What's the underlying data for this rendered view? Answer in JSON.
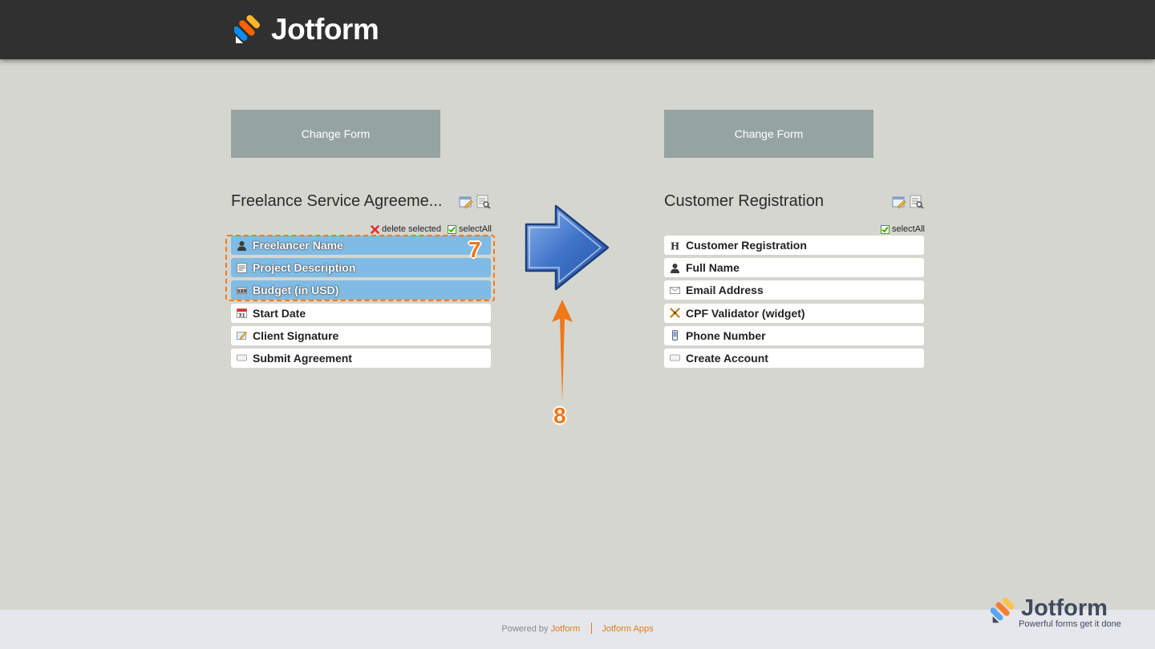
{
  "app": {
    "name": "Jotform"
  },
  "left": {
    "change_button": "Change Form",
    "title": "Freelance Service Agreeme...",
    "delete_selected": "delete selected",
    "select_all": "selectAll",
    "fields": [
      {
        "label": "Freelancer Name",
        "icon": "person-icon",
        "selected": true
      },
      {
        "label": "Project Description",
        "icon": "textarea-icon",
        "selected": true
      },
      {
        "label": "Budget (in USD)",
        "icon": "number-icon",
        "selected": true
      },
      {
        "label": "Start Date",
        "icon": "calendar-icon",
        "selected": false
      },
      {
        "label": "Client Signature",
        "icon": "signature-icon",
        "selected": false
      },
      {
        "label": "Submit Agreement",
        "icon": "button-icon",
        "selected": false
      }
    ]
  },
  "right": {
    "change_button": "Change Form",
    "title": "Customer Registration",
    "select_all": "selectAll",
    "fields": [
      {
        "label": "Customer Registration",
        "icon": "heading-icon"
      },
      {
        "label": "Full Name",
        "icon": "person-icon"
      },
      {
        "label": "Email Address",
        "icon": "email-icon"
      },
      {
        "label": "CPF Validator (widget)",
        "icon": "widget-icon"
      },
      {
        "label": "Phone Number",
        "icon": "phone-icon"
      },
      {
        "label": "Create Account",
        "icon": "button-icon"
      }
    ]
  },
  "annotations": {
    "step7": "7",
    "step8": "8"
  },
  "footer": {
    "powered_by": "Powered by",
    "jotform_link": "Jotform",
    "apps_link": "Jotform Apps",
    "logo_name": "Jotform",
    "logo_tagline": "Powerful forms get it done"
  },
  "colors": {
    "header": "#303030",
    "accent": "#ef7a1f",
    "selected_field": "#7fbbe4",
    "change_button": "#96a3a3"
  }
}
